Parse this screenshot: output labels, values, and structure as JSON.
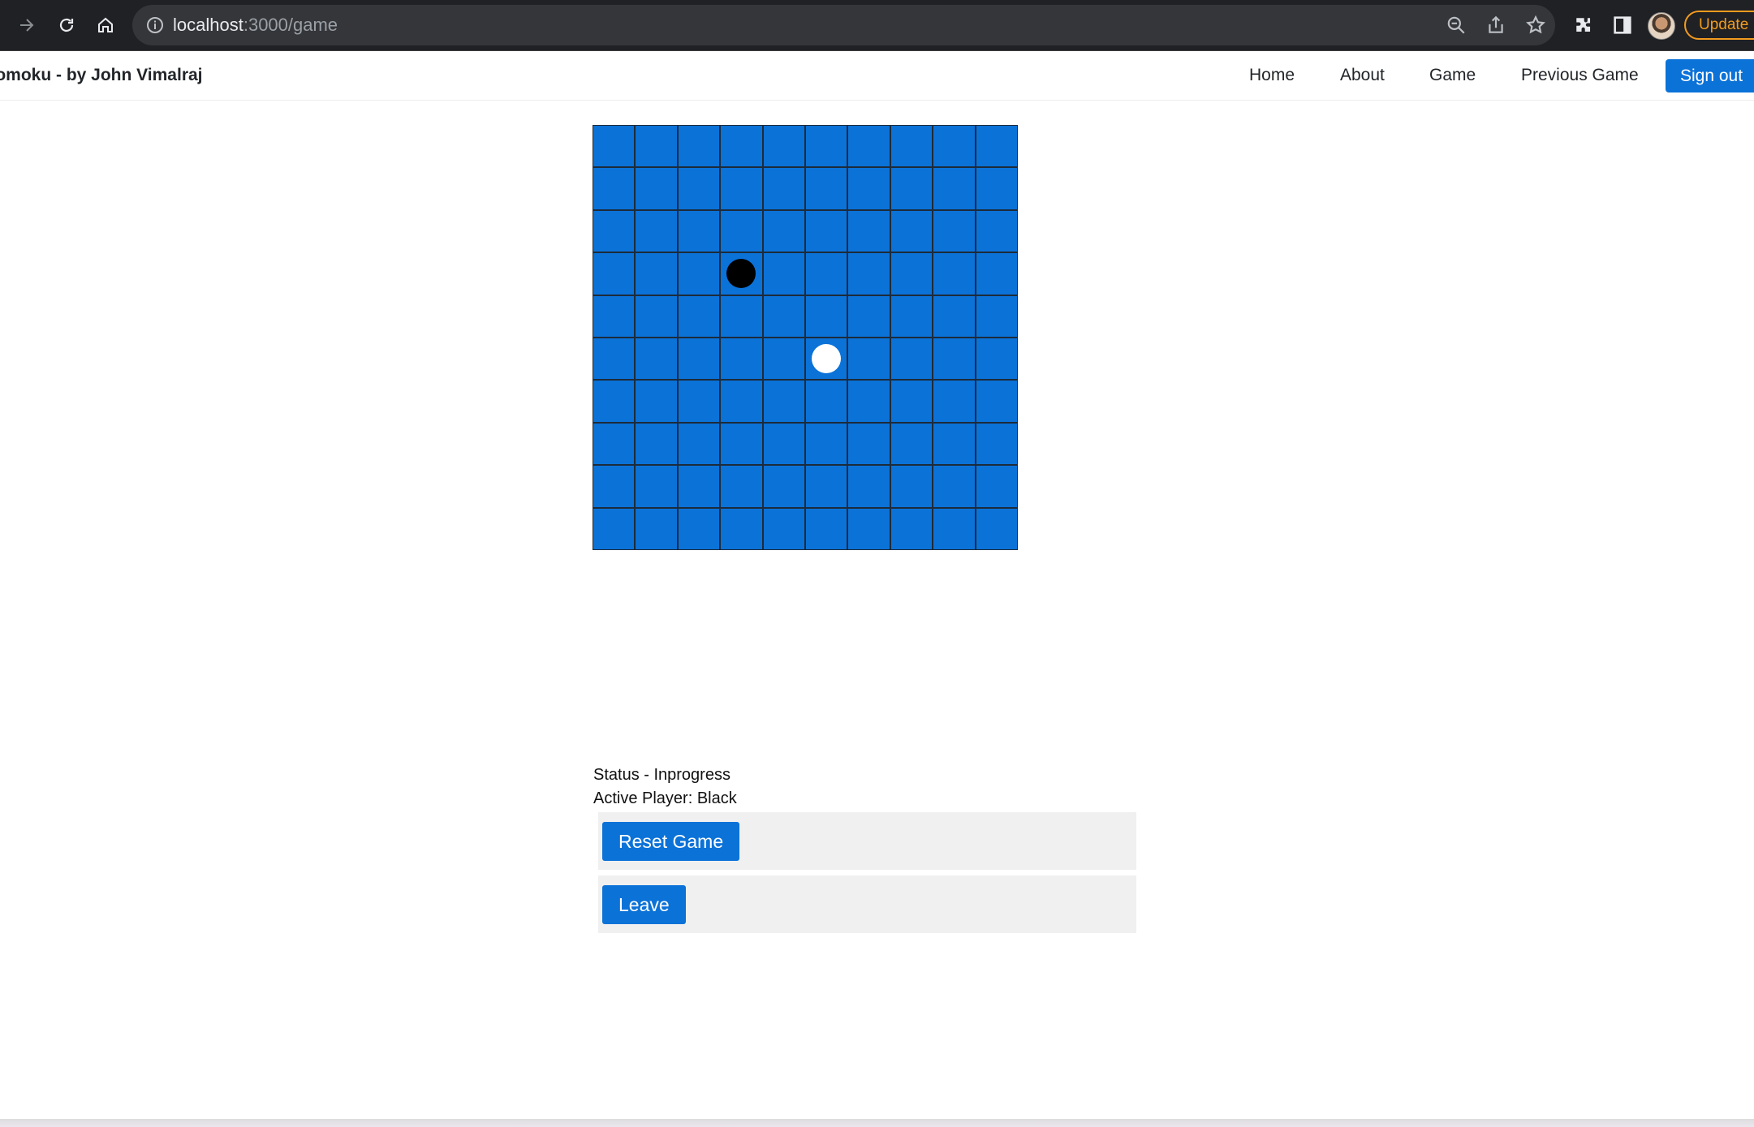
{
  "browser": {
    "url_host": "localhost",
    "url_path": ":3000/game",
    "update_label": "Update"
  },
  "navbar": {
    "brand": "Gomoku - by John Vimalraj",
    "links": [
      "Home",
      "About",
      "Game",
      "Previous Game"
    ],
    "signout_label": "Sign out"
  },
  "board": {
    "size": 10,
    "stones": [
      {
        "row": 3,
        "col": 3,
        "color": "black"
      },
      {
        "row": 5,
        "col": 5,
        "color": "white"
      }
    ],
    "cell_color": "#0b72d8"
  },
  "status": {
    "status_text": "Status - Inprogress",
    "active_player_text": "Active Player: Black"
  },
  "controls": {
    "reset_label": "Reset Game",
    "leave_label": "Leave"
  },
  "colors": {
    "accent": "#0b72d8",
    "chrome_bg": "#202124",
    "update_orange": "#f29b1f"
  }
}
